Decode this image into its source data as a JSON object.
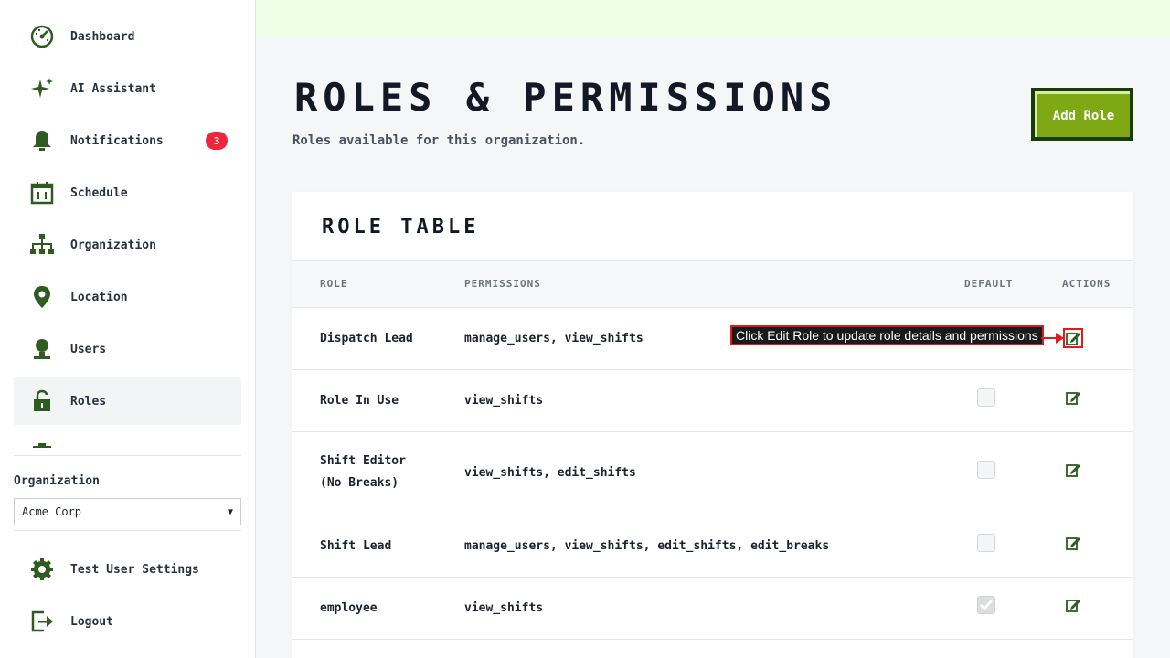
{
  "sidebar": {
    "items": [
      {
        "label": "Dashboard",
        "icon": "dashboard-icon"
      },
      {
        "label": "AI Assistant",
        "icon": "sparkle-icon"
      },
      {
        "label": "Notifications",
        "icon": "bell-icon",
        "badge": "3"
      },
      {
        "label": "Schedule",
        "icon": "calendar-icon"
      },
      {
        "label": "Organization",
        "icon": "org-chart-icon"
      },
      {
        "label": "Location",
        "icon": "location-pin-icon"
      },
      {
        "label": "Users",
        "icon": "user-icon"
      },
      {
        "label": "Roles",
        "icon": "unlock-icon",
        "active": true
      }
    ],
    "org_label": "Organization",
    "org_selected": "Acme Corp",
    "bottom": [
      {
        "label": "Test User Settings",
        "icon": "gear-icon"
      },
      {
        "label": "Logout",
        "icon": "logout-icon"
      }
    ]
  },
  "header": {
    "title": "Roles & Permissions",
    "subtitle": "Roles available for this organization.",
    "add_button": "Add Role"
  },
  "table": {
    "title": "Role Table",
    "columns": [
      "ROLE",
      "PERMISSIONS",
      "DEFAULT",
      "ACTIONS"
    ],
    "rows": [
      {
        "role": "Dispatch Lead",
        "permissions": "manage_users, view_shifts",
        "default": null
      },
      {
        "role": "Role In Use",
        "permissions": "view_shifts",
        "default": false
      },
      {
        "role": "Shift Editor (No Breaks)",
        "permissions": "view_shifts, edit_shifts",
        "default": false
      },
      {
        "role": "Shift Lead",
        "permissions": "manage_users, view_shifts, edit_shifts, edit_breaks",
        "default": false
      },
      {
        "role": "employee",
        "permissions": "view_shifts",
        "default": true
      }
    ]
  },
  "tooltip": {
    "text": "Click Edit Role to update role details and permissions"
  },
  "colors": {
    "accent_green": "#7ea915",
    "dark_green": "#1b3a0c",
    "icon_green": "#2e5b1f",
    "badge_red": "#f0243a",
    "highlight_red": "#e41a1a"
  }
}
